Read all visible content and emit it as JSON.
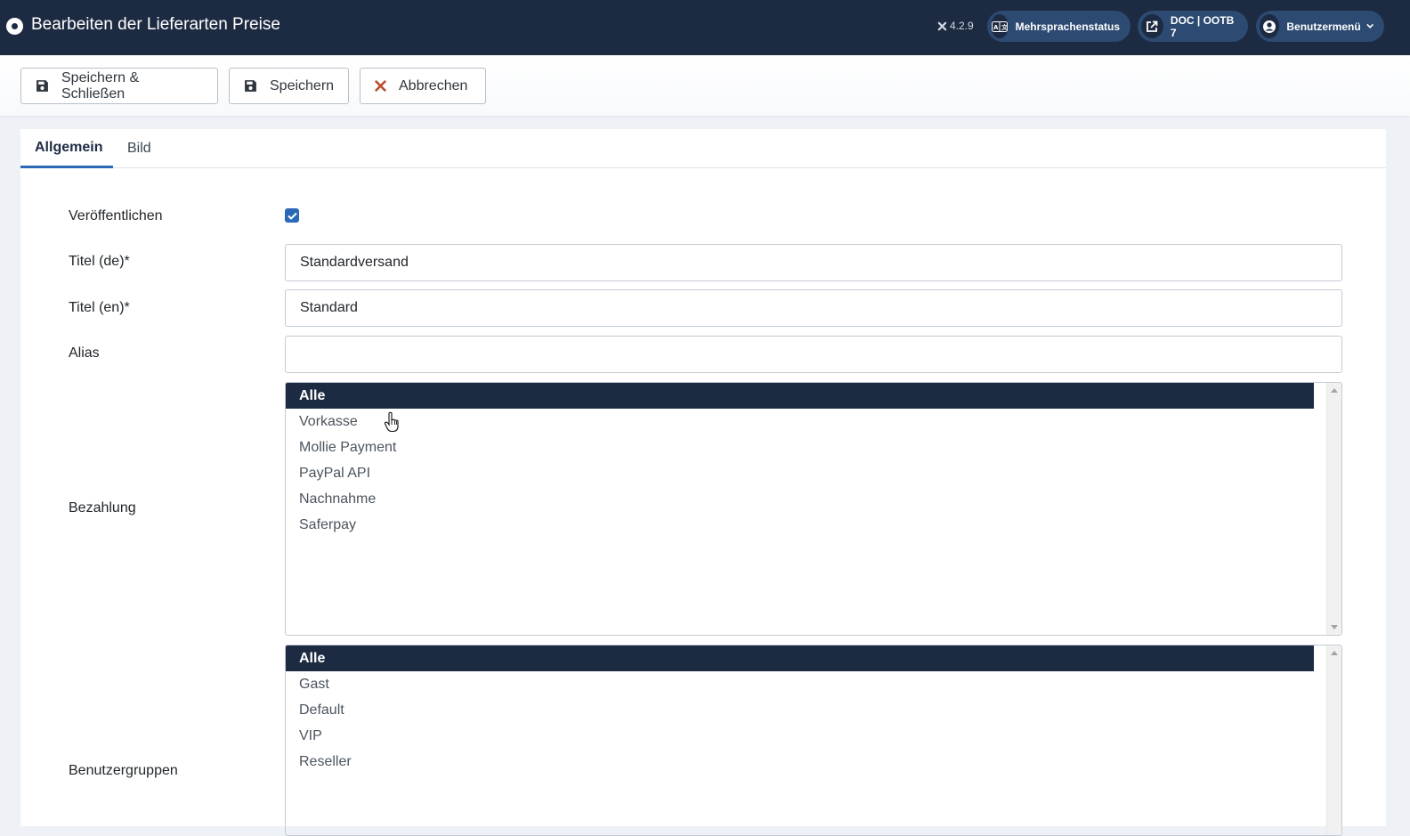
{
  "header": {
    "title": "Bearbeiten der Lieferarten Preise",
    "version": "4.2.9",
    "multilang_label": "Mehrsprachenstatus",
    "doc_label": "DOC | OOTB 7",
    "user_menu_label": "Benutzermenü"
  },
  "toolbar": {
    "save_close_label": "Speichern & Schließen",
    "save_label": "Speichern",
    "cancel_label": "Abbrechen",
    "cancel_color": "#b64b2a"
  },
  "tabs": [
    {
      "label": "Allgemein",
      "active": true
    },
    {
      "label": "Bild",
      "active": false
    }
  ],
  "form": {
    "publish_label": "Veröffentlichen",
    "publish_checked": true,
    "title_de_label": "Titel (de)*",
    "title_de_value": "Standardversand",
    "title_en_label": "Titel (en)*",
    "title_en_value": "Standard",
    "alias_label": "Alias",
    "alias_value": "",
    "payment_label": "Bezahlung",
    "payment_options": [
      "Alle",
      "Vorkasse",
      "Mollie Payment",
      "PayPal API",
      "Nachnahme",
      "Saferpay"
    ],
    "payment_selected": "Alle",
    "usergroups_label": "Benutzergruppen",
    "usergroup_options": [
      "Alle",
      "Gast",
      "Default",
      "VIP",
      "Reseller"
    ],
    "usergroup_selected": "Alle"
  },
  "colors": {
    "header_bg": "#1d2b42",
    "pill_bg": "#2d4a72",
    "accent": "#2a69b8"
  }
}
